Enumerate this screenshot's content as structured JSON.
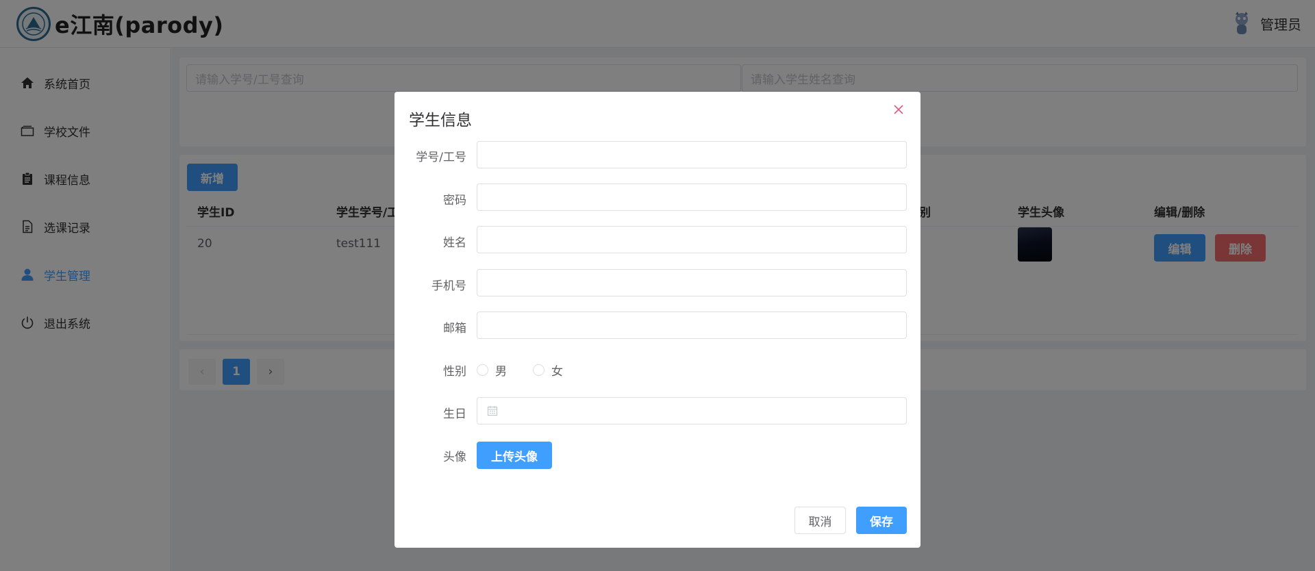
{
  "header": {
    "title": "e江南(parody)",
    "user": "管理员"
  },
  "sidebar": {
    "items": [
      {
        "label": "系统首页",
        "icon": "home-icon"
      },
      {
        "label": "学校文件",
        "icon": "folder-icon"
      },
      {
        "label": "课程信息",
        "icon": "clipboard-icon"
      },
      {
        "label": "选课记录",
        "icon": "document-icon"
      },
      {
        "label": "学生管理",
        "icon": "user-icon",
        "active": true
      },
      {
        "label": "退出系统",
        "icon": "power-icon"
      }
    ]
  },
  "search": {
    "id_placeholder": "请输入学号/工号查询",
    "name_placeholder": "请输入学生姓名查询"
  },
  "toolbar": {
    "add_label": "新增"
  },
  "table": {
    "headers": [
      "学生ID",
      "学生学号/工",
      "别",
      "学生头像",
      "编辑/删除"
    ],
    "row": {
      "id": "20",
      "student_no": "test111"
    },
    "edit_label": "编辑",
    "delete_label": "删除"
  },
  "pagination": {
    "current": "1",
    "prev": "‹",
    "next": "›"
  },
  "dialog": {
    "title": "学生信息",
    "labels": {
      "student_no": "学号/工号",
      "password": "密码",
      "name": "姓名",
      "phone": "手机号",
      "email": "邮箱",
      "gender": "性别",
      "birthday": "生日",
      "avatar": "头像"
    },
    "gender_options": [
      "男",
      "女"
    ],
    "upload_label": "上传头像",
    "cancel_label": "取消",
    "save_label": "保存"
  },
  "colors": {
    "primary": "#409eff",
    "danger": "#f56c6c",
    "overlay": "rgba(0,0,0,0.5)"
  }
}
